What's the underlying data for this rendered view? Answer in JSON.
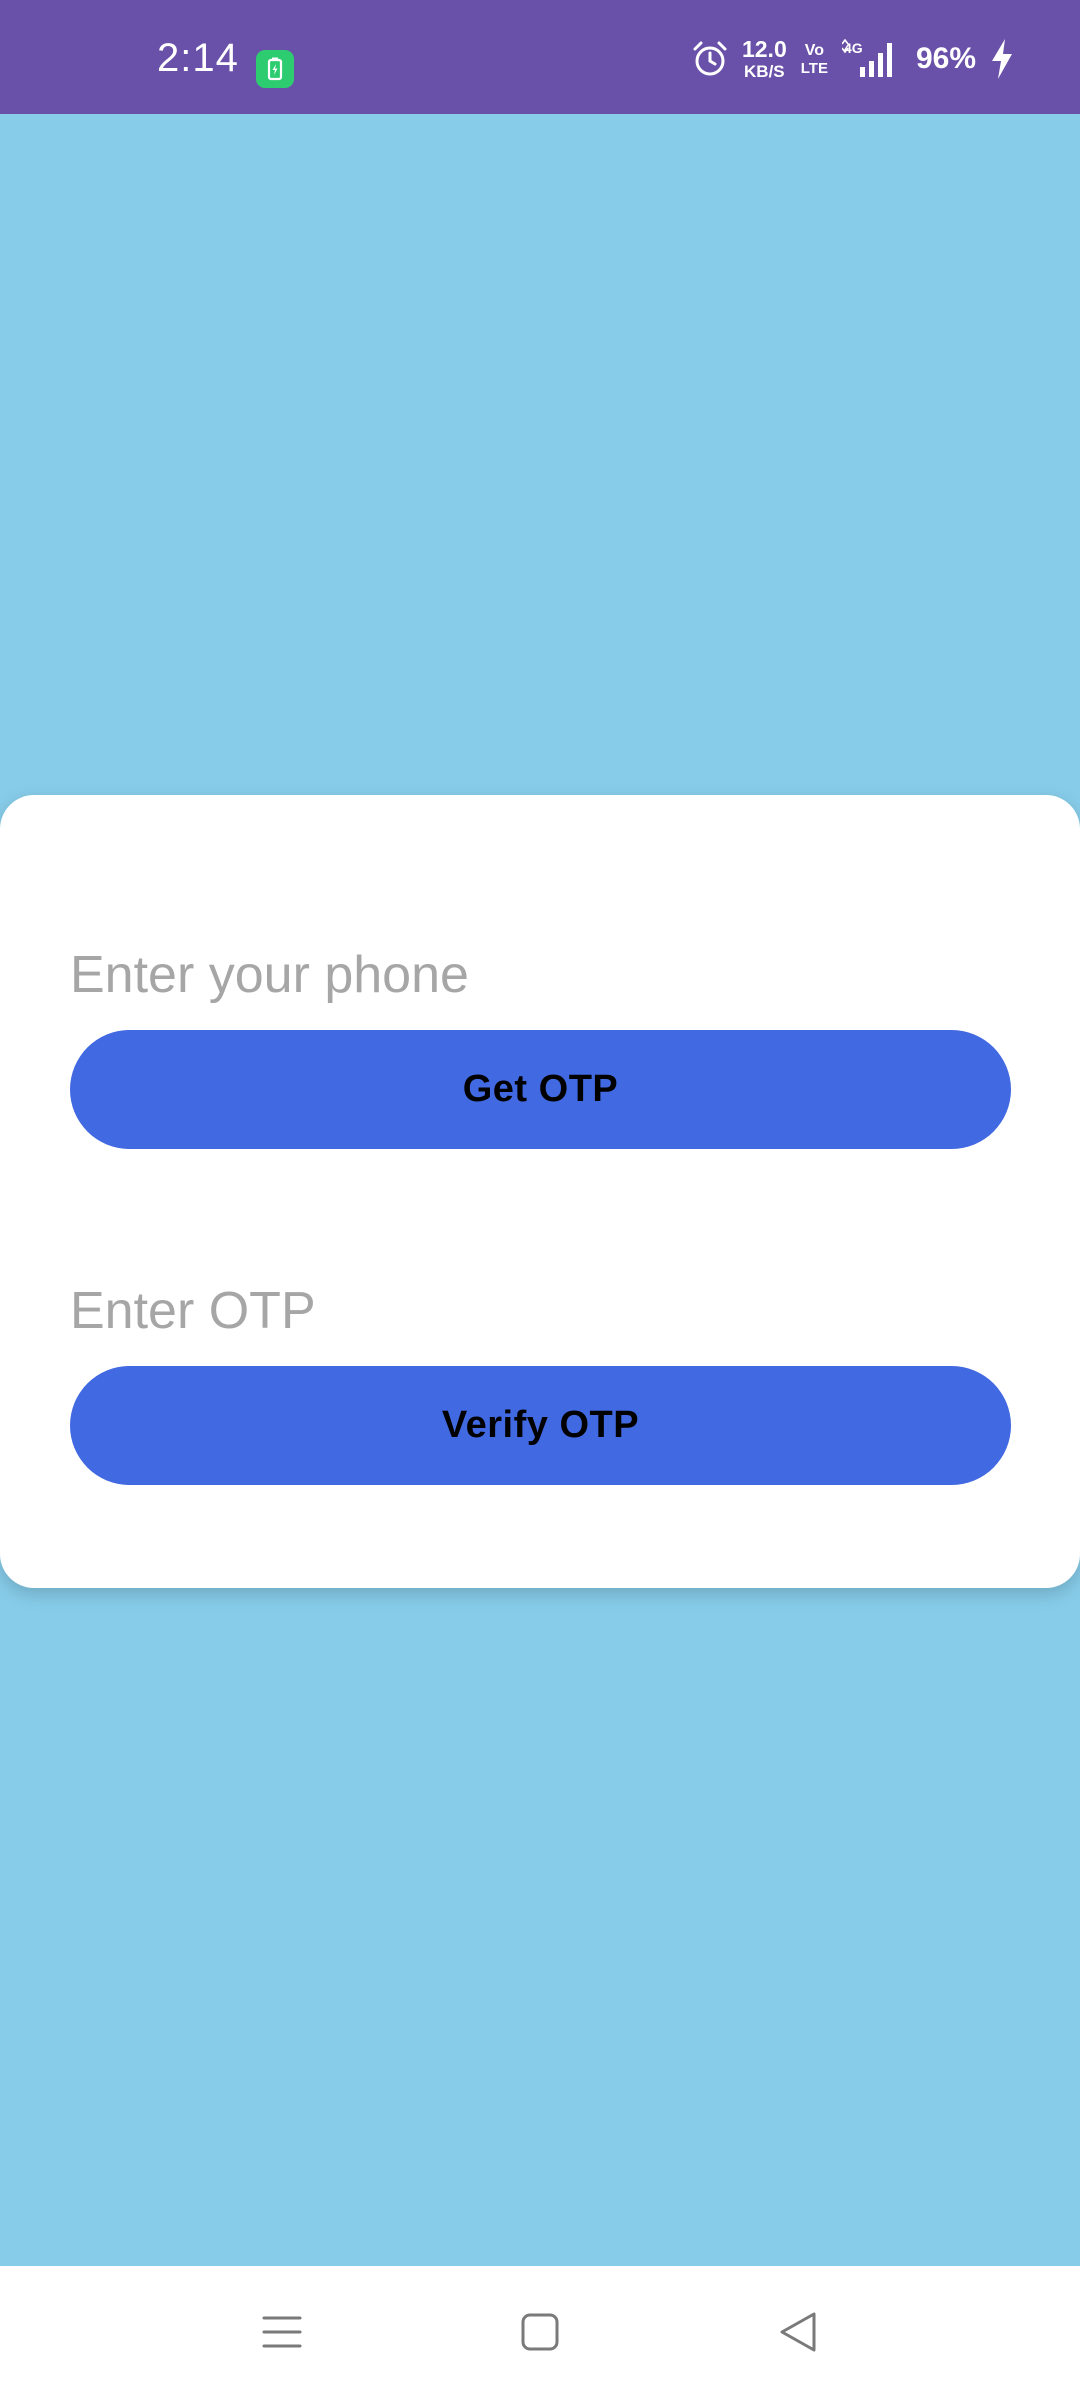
{
  "status_bar": {
    "time": "2:14",
    "netspeed_value": "12.0",
    "netspeed_unit": "KB/S",
    "volte_top": "Vo",
    "volte_bottom": "LTE",
    "network": "4G",
    "battery": "96%",
    "icons": [
      "battery-saver-icon",
      "alarm-icon",
      "signal-icon",
      "charging-bolt-icon"
    ]
  },
  "form": {
    "phone_placeholder": "Enter your phone",
    "get_otp_label": "Get OTP",
    "otp_placeholder": "Enter OTP",
    "verify_otp_label": "Verify OTP"
  },
  "nav_bar": {
    "icons": [
      "menu-icon",
      "home-icon",
      "back-icon"
    ]
  },
  "colors": {
    "status_bar": "#6950A8",
    "background": "#87CDEA",
    "card": "#FFFFFF",
    "button": "#4169E1",
    "button_text": "#000000",
    "placeholder": "#A6A6A6",
    "battery_saver": "#2ECC71"
  }
}
